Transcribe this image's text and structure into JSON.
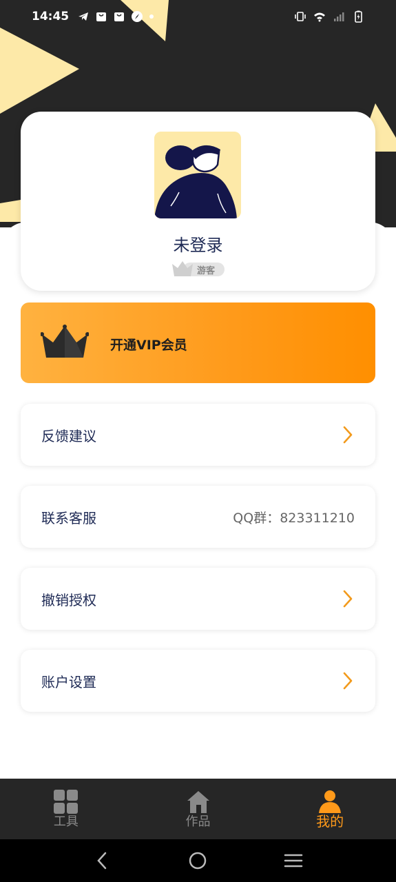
{
  "status_bar": {
    "time": "14:45"
  },
  "profile": {
    "name": "未登录",
    "badge": "游客"
  },
  "vip": {
    "label": "开通VIP会员"
  },
  "menu": {
    "feedback": {
      "label": "反馈建议",
      "icon": "chevron-right-icon"
    },
    "contact": {
      "label": "联系客服",
      "value": "QQ群：823311210"
    },
    "revoke": {
      "label": "撤销授权",
      "icon": "chevron-right-icon"
    },
    "account": {
      "label": "账户设置",
      "icon": "chevron-right-icon"
    }
  },
  "tabs": [
    {
      "label": "工具",
      "icon": "grid-icon",
      "active": false
    },
    {
      "label": "作品",
      "icon": "house-icon",
      "active": false
    },
    {
      "label": "我的",
      "icon": "person-icon",
      "active": true
    }
  ],
  "colors": {
    "accent": "#ff9a1a",
    "dark": "#262626",
    "text_primary": "#1e2a55",
    "triangle": "#fde9a8"
  }
}
